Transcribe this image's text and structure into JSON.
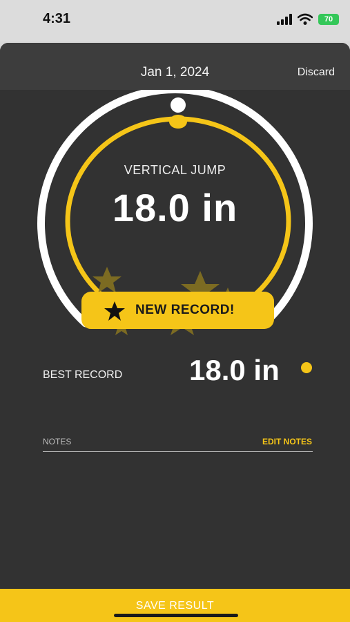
{
  "status_bar": {
    "time": "4:31",
    "battery": "70"
  },
  "header": {
    "date": "Jan 1, 2024",
    "discard_label": "Discard"
  },
  "result": {
    "metric_label": "VERTICAL JUMP",
    "value": "18.0 in",
    "badge_label": "NEW RECORD!"
  },
  "best_record": {
    "label": "BEST RECORD",
    "value": "18.0 in"
  },
  "notes": {
    "label": "NOTES",
    "edit_label": "EDIT NOTES"
  },
  "footer": {
    "save_label": "SAVE RESULT"
  },
  "colors": {
    "accent": "#f5c518",
    "background": "#323232",
    "header": "#3d3d3d"
  }
}
